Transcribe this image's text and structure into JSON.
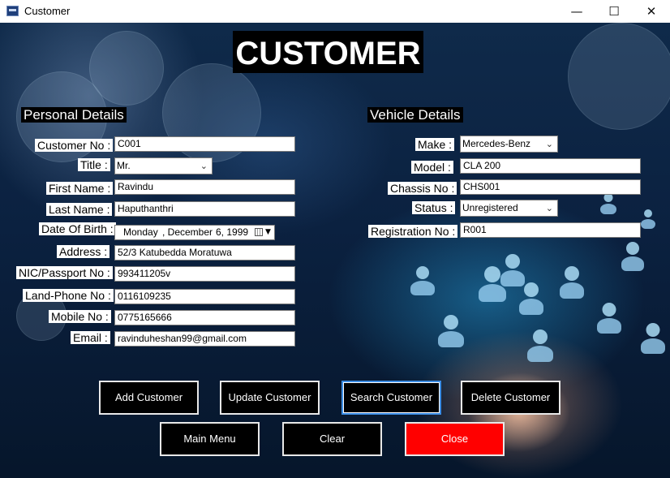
{
  "window": {
    "title": "Customer",
    "controls": {
      "minimize": "—",
      "maximize": "☐",
      "close": "✕"
    }
  },
  "heading": "CUSTOMER",
  "personal": {
    "section_title": "Personal Details",
    "customer_no": {
      "label": "Customer No :",
      "value": "C001"
    },
    "title": {
      "label": "Title :",
      "value": "Mr."
    },
    "first_name": {
      "label": "First Name :",
      "value": "Ravindu"
    },
    "last_name": {
      "label": "Last Name :",
      "value": "Haputhanthri"
    },
    "dob": {
      "label": "Date Of Birth :",
      "day": "Monday",
      "month": ",   December",
      "date": "6, 1999"
    },
    "address": {
      "label": "Address :",
      "value": "52/3 Katubedda Moratuwa"
    },
    "nic": {
      "label": "NIC/Passport No :",
      "value": "993411205v"
    },
    "land_phone": {
      "label": "Land-Phone No :",
      "value": "0116109235"
    },
    "mobile": {
      "label": "Mobile No :",
      "value": "0775165666"
    },
    "email": {
      "label": "Email :",
      "value": "ravinduheshan99@gmail.com"
    }
  },
  "vehicle": {
    "section_title": "Vehicle Details",
    "make": {
      "label": "Make :",
      "value": "Mercedes-Benz"
    },
    "model": {
      "label": "Model :",
      "value": "CLA 200"
    },
    "chassis": {
      "label": "Chassis No :",
      "value": "CHS001"
    },
    "status": {
      "label": "Status :",
      "value": "Unregistered"
    },
    "registration": {
      "label": "Registration No :",
      "value": "R001"
    }
  },
  "buttons": {
    "add": "Add Customer",
    "update": "Update Customer",
    "search": "Search Customer",
    "delete": "Delete Customer",
    "main_menu": "Main Menu",
    "clear": "Clear",
    "close": "Close"
  },
  "colors": {
    "close_button": "#ff0000",
    "focus_border": "#3c8ee6",
    "button_bg": "#000000"
  }
}
